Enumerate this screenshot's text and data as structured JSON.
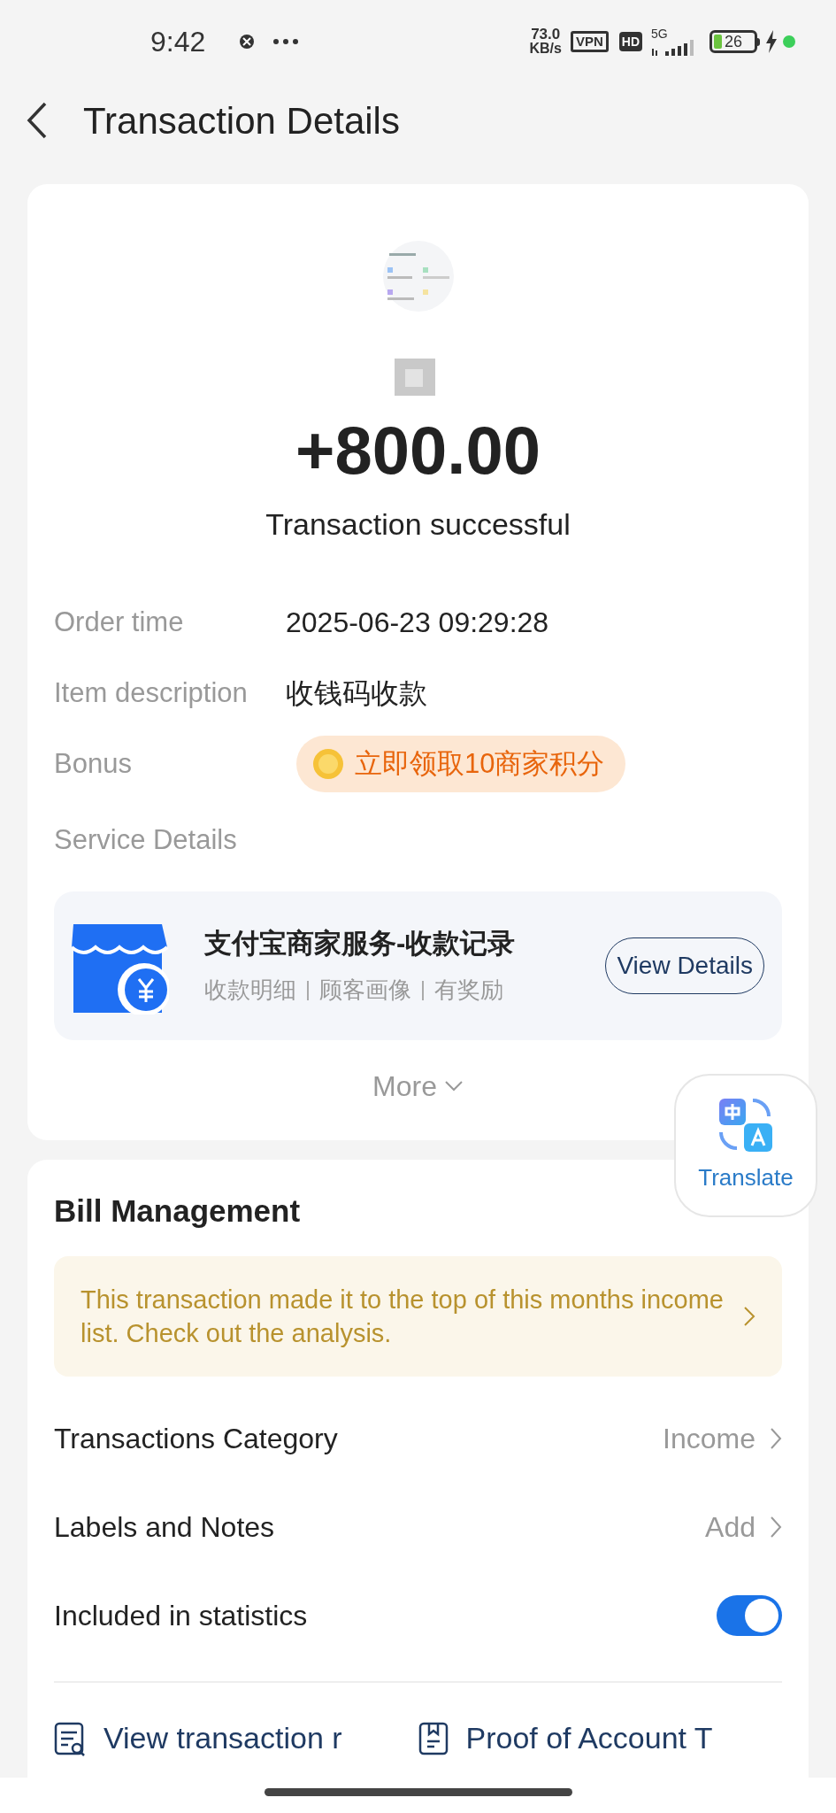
{
  "status_bar": {
    "time": "9:42",
    "speed_value": "73.0",
    "speed_unit": "KB/s",
    "vpn": "VPN",
    "hd": "HD",
    "network": "5G",
    "battery": "26"
  },
  "header": {
    "title": "Transaction Details"
  },
  "summary": {
    "amount": "+800.00",
    "status": "Transaction successful",
    "fields": [
      {
        "label": "Order time",
        "value": "2025-06-23 09:29:28",
        "kind": "text"
      },
      {
        "label": "Item description",
        "value": "收钱码收款",
        "kind": "text"
      },
      {
        "label": "Bonus",
        "value": "立即领取10商家积分",
        "kind": "bonus"
      }
    ],
    "service_label": "Service Details",
    "service": {
      "title": "支付宝商家服务-收款记录",
      "tags": [
        "收款明细",
        "顾客画像",
        "有奖励"
      ],
      "button": "View Details"
    },
    "more": "More"
  },
  "translate_button": {
    "label": "Translate"
  },
  "bill_management": {
    "title": "Bill Management",
    "notice": "This transaction made it to the top of this months income list. Check out the analysis.",
    "rows": [
      {
        "label": "Transactions Category",
        "value": "Income",
        "kind": "link"
      },
      {
        "label": "Labels and Notes",
        "value": "Add",
        "kind": "link"
      },
      {
        "label": "Included in statistics",
        "kind": "toggle",
        "on": true
      }
    ],
    "links": [
      {
        "label": "View transaction r",
        "kind": "records"
      },
      {
        "label": "Proof of Account T",
        "kind": "proof"
      }
    ]
  }
}
